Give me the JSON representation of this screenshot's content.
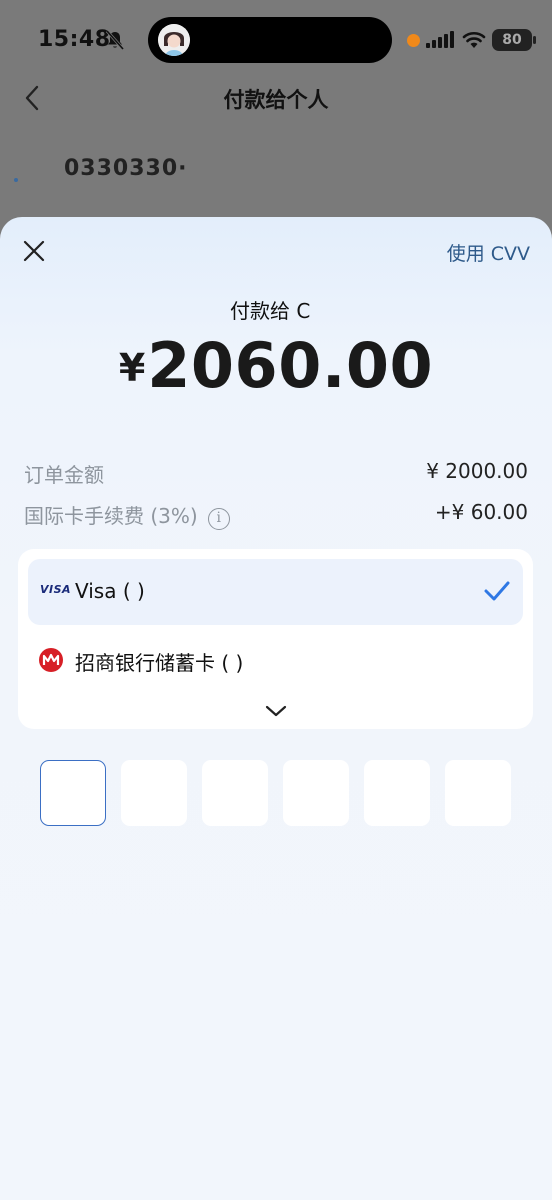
{
  "status_bar": {
    "time": "15:48",
    "battery": "80",
    "icons": [
      "bell-mute-icon",
      "recording-dot-icon",
      "signal-icon",
      "wifi-icon",
      "battery-icon"
    ]
  },
  "nav": {
    "title": "付款给个人",
    "back_icon": "chevron-left-icon"
  },
  "background": {
    "partial_text": "0330330·"
  },
  "sheet": {
    "close_icon": "close-icon",
    "cvv_link": "使用 CVV",
    "payee_label": "付款给 C",
    "currency_symbol": "¥",
    "amount": "2060.00",
    "order_amount_label": "订单金额",
    "order_amount_value": "¥ 2000.00",
    "fee_label": "国际卡手续费 (3%)",
    "fee_value": "+¥ 60.00",
    "cards": [
      {
        "logo": "VISA",
        "label": "Visa (     )",
        "selected": true
      },
      {
        "logo": "cmb-bank-logo",
        "label": "招商银行储蓄卡 (     )",
        "selected": false
      }
    ],
    "expand_icon": "chevron-down-icon",
    "pin_box_count": 6,
    "colors": {
      "accent": "#2f78e4",
      "link": "#2e5a8a",
      "bank_red": "#d71f26"
    }
  }
}
